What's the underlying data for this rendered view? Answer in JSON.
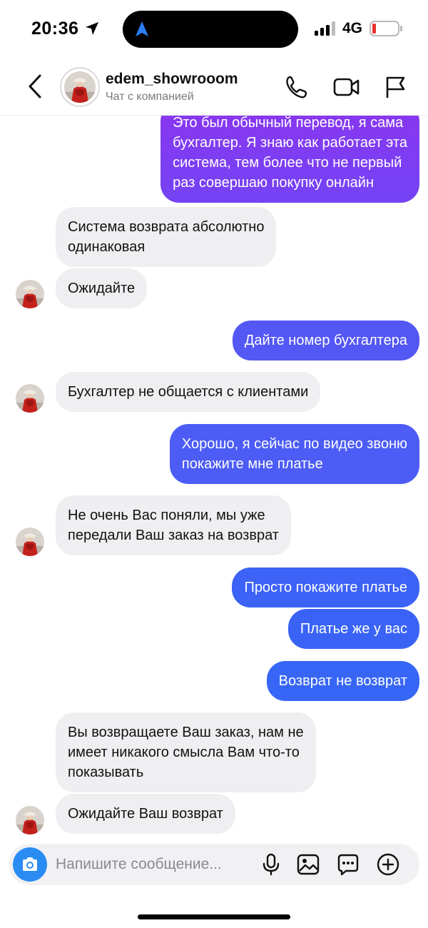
{
  "status_bar": {
    "time": "20:36",
    "network": "4G"
  },
  "header": {
    "name": "edem_showrooom",
    "subtitle": "Чат с компанией"
  },
  "colors": {
    "outgoing_gradient_top": "#7d3cf2",
    "outgoing_gradient_bottom": "#3d5bf6",
    "incoming_bg": "#efeff2",
    "camera_button": "#2a8cf3"
  },
  "messages": [
    {
      "side": "out",
      "lines": [
        "Это был обычный перевод, я сама",
        "бухгалтер. Я знаю как работает эта",
        "система, тем более что не первый",
        "раз совершаю покупку онлайн"
      ]
    },
    {
      "side": "in",
      "lines": [
        "Система возврата абсолютно",
        "одинаковая"
      ]
    },
    {
      "side": "in",
      "lines": [
        "Ожидайте"
      ]
    },
    {
      "side": "out",
      "lines": [
        "Дайте номер бухгалтера"
      ]
    },
    {
      "side": "in",
      "lines": [
        "Бухгалтер не общается с клиентами"
      ]
    },
    {
      "side": "out",
      "lines": [
        "Хорошо, я сейчас по видео звоню",
        "покажите мне платье"
      ]
    },
    {
      "side": "in",
      "lines": [
        "Не очень Вас поняли, мы уже",
        "передали Ваш заказ на возврат"
      ]
    },
    {
      "side": "out",
      "lines": [
        "Просто покажите платье"
      ]
    },
    {
      "side": "out",
      "lines": [
        "Платье же у вас"
      ]
    },
    {
      "side": "out",
      "lines": [
        "Возврат не возврат"
      ]
    },
    {
      "side": "in",
      "lines": [
        "Вы возвращаете Ваш заказ, нам не",
        "имеет никакого смысла Вам что-то",
        "показывать"
      ]
    },
    {
      "side": "in",
      "lines": [
        "Ожидайте Ваш возврат"
      ]
    }
  ],
  "composer": {
    "placeholder": "Напишите сообщение..."
  },
  "icons": {
    "back": "chevron-left-icon",
    "call": "phone-icon",
    "video": "video-camera-icon",
    "report": "flag-icon",
    "camera": "camera-icon",
    "mic": "microphone-icon",
    "gallery": "image-icon",
    "sticker": "sticker-icon",
    "add": "plus-icon"
  }
}
